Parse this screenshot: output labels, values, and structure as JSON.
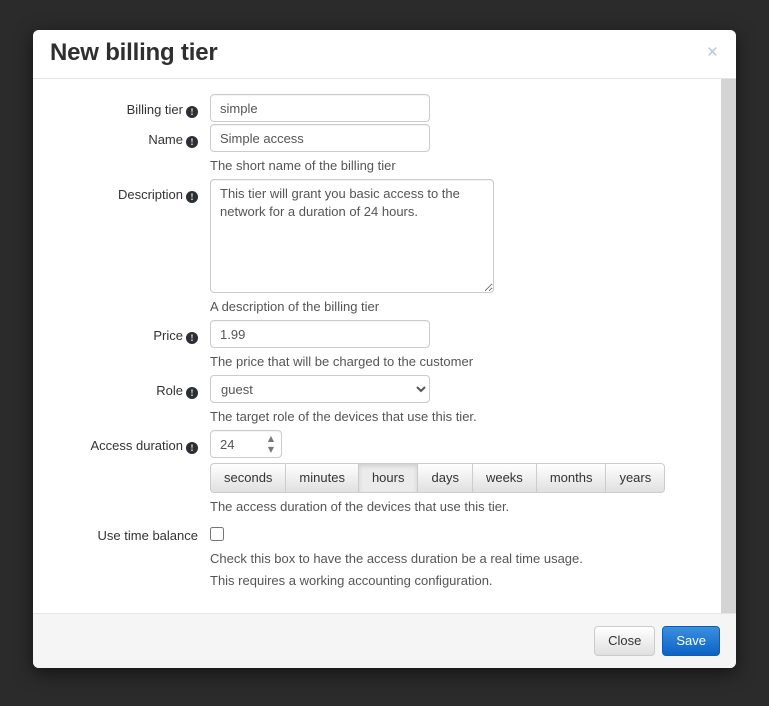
{
  "modal": {
    "title": "New billing tier",
    "close_icon": "close-icon",
    "close_symbol": "×",
    "info_icon_glyph": "!"
  },
  "form": {
    "billing_tier": {
      "label": "Billing tier",
      "value": "simple",
      "help": "The short name of the billing tier"
    },
    "name": {
      "label": "Name",
      "value": "Simple access"
    },
    "description": {
      "label": "Description",
      "value": "This tier will grant you basic access to the network for a duration of 24 hours.",
      "help": "A description of the billing tier"
    },
    "price": {
      "label": "Price",
      "value": "1.99",
      "help": "The price that will be charged to the customer"
    },
    "role": {
      "label": "Role",
      "value": "guest",
      "options": [
        "guest"
      ],
      "help": "The target role of the devices that use this tier."
    },
    "access_duration": {
      "label": "Access duration",
      "value": "24",
      "units": [
        "seconds",
        "minutes",
        "hours",
        "days",
        "weeks",
        "months",
        "years"
      ],
      "selected_unit": "hours",
      "help": "The access duration of the devices that use this tier.",
      "spinner_up": "▲",
      "spinner_down": "▼"
    },
    "use_time_balance": {
      "label": "Use time balance",
      "checked": false,
      "help_line1": "Check this box to have the access duration be a real time usage.",
      "help_line2": "This requires a working accounting configuration."
    }
  },
  "footer": {
    "close_label": "Close",
    "save_label": "Save"
  },
  "colors": {
    "backdrop": "#2b2b2b",
    "modal_bg": "#ffffff",
    "footer_bg": "#f5f5f5",
    "save_accent": "#0a63c6",
    "scrollbar": "#d4d4d4",
    "active_unit": "#ebebeb"
  }
}
